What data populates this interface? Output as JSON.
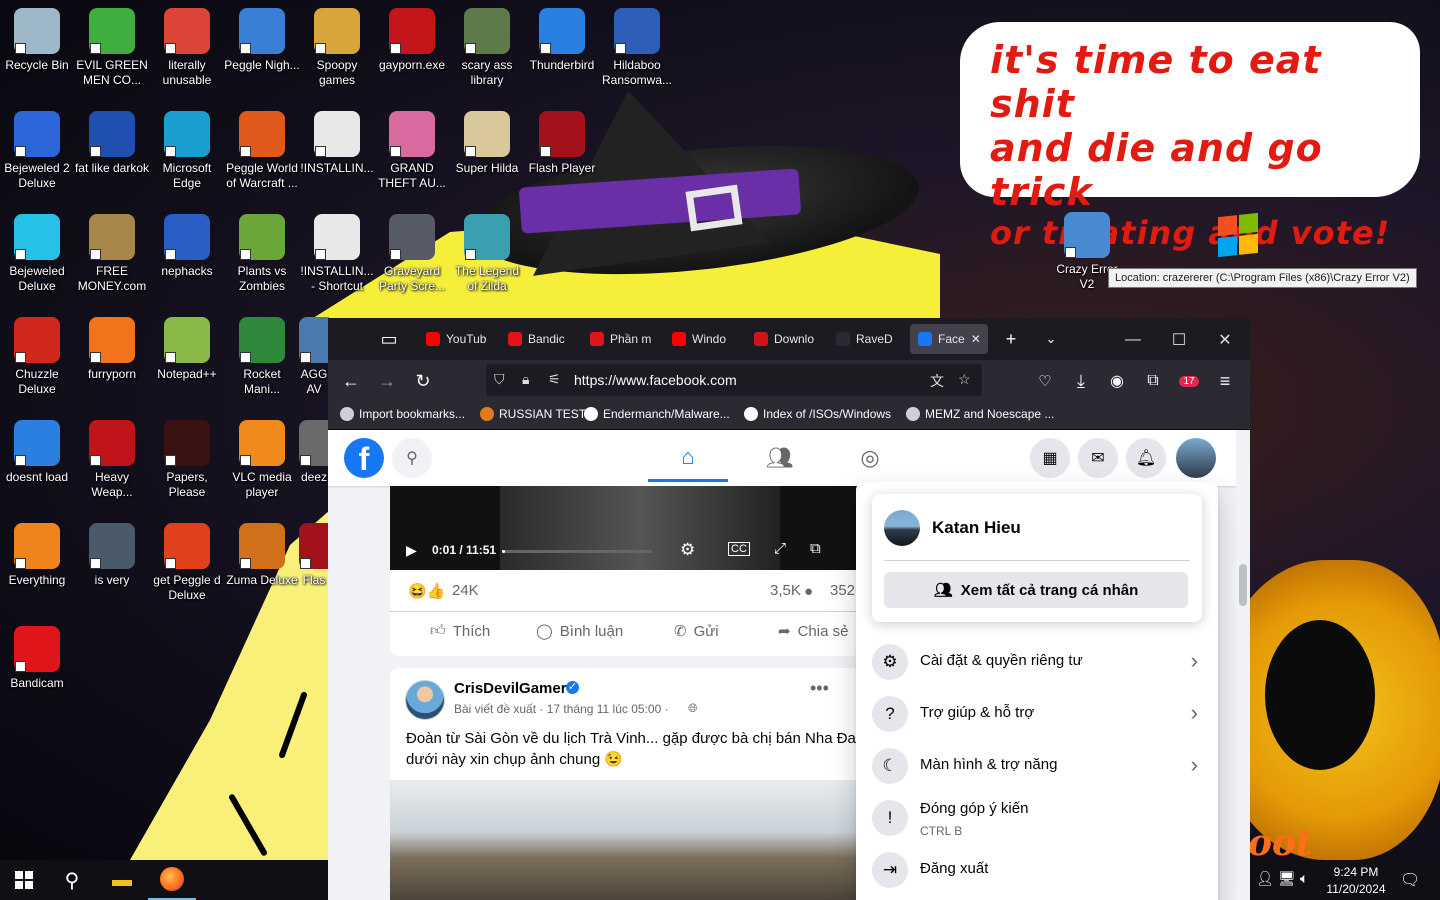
{
  "desktop": {
    "speech_bubble": [
      "it's time to eat shit",
      "and die and go trick",
      "or treating and vote!"
    ],
    "pumpkin_text": "oot",
    "icons": [
      {
        "label": "Recycle Bin",
        "icon": "recycle-bin-icon",
        "color": "#9fb8c9"
      },
      {
        "label": "EVIL GREEN MEN CO...",
        "icon": "people-icon",
        "color": "#3fae3f"
      },
      {
        "label": "literally unusable",
        "icon": "chrome-icon",
        "color": "#db4437"
      },
      {
        "label": "Peggle Nigh...",
        "icon": "peggle-icon",
        "color": "#3a7fd6"
      },
      {
        "label": "Spoopy games",
        "icon": "folder-icon",
        "color": "#d7a63a"
      },
      {
        "label": "gayporn.exe",
        "icon": "flash-icon",
        "color": "#c4151b"
      },
      {
        "label": "scary ass library",
        "icon": "library-icon",
        "color": "#5f7a4a"
      },
      {
        "label": "Thunderbird",
        "icon": "thunderbird-icon",
        "color": "#2a7fe0"
      },
      {
        "label": "Hildaboo Ransomwa...",
        "icon": "shield-icon",
        "color": "#2d5fb8"
      },
      {
        "label": "Bejeweled 2 Deluxe",
        "icon": "bejeweled-icon",
        "color": "#2c66d8"
      },
      {
        "label": "fat like darkok",
        "icon": "mpi-icon",
        "color": "#1f4fb0"
      },
      {
        "label": "Microsoft Edge",
        "icon": "edge-icon",
        "color": "#1aa0d0"
      },
      {
        "label": "Peggle World of Warcraft ...",
        "icon": "peggle-icon",
        "color": "#e05a1c"
      },
      {
        "label": "!INSTALLIN...",
        "icon": "document-icon",
        "color": "#e8e8e8"
      },
      {
        "label": "GRAND THEFT AU...",
        "icon": "gta-icon",
        "color": "#d86aa0"
      },
      {
        "label": "Super Hilda",
        "icon": "pixel-icon",
        "color": "#d9c89a"
      },
      {
        "label": "Flash Player",
        "icon": "flash-icon",
        "color": "#a5111a"
      },
      {
        "label": "Bejeweled Deluxe",
        "icon": "diamond-icon",
        "color": "#27c1e8"
      },
      {
        "label": "FREE MONEY.com",
        "icon": "money-bag-icon",
        "color": "#a8874a"
      },
      {
        "label": "nephacks",
        "icon": "mpi-icon",
        "color": "#2a5ec4"
      },
      {
        "label": "Plants vs Zombies",
        "icon": "flower-icon",
        "color": "#6aa63a"
      },
      {
        "label": "!INSTALLIN... - Shortcut",
        "icon": "document-icon",
        "color": "#e8e8e8"
      },
      {
        "label": "Graveyard Party Scre...",
        "icon": "grave-icon",
        "color": "#555a66"
      },
      {
        "label": "The Legend of Zilda",
        "icon": "zilda-icon",
        "color": "#3aa0b0"
      },
      {
        "label": "Chuzzle Deluxe",
        "icon": "chuzzle-icon",
        "color": "#d0281c"
      },
      {
        "label": "furryporn",
        "icon": "firefox-icon",
        "color": "#f2731c"
      },
      {
        "label": "Notepad++",
        "icon": "notepad-icon",
        "color": "#8ab94a"
      },
      {
        "label": "Rocket Mani...",
        "icon": "rocket-icon",
        "color": "#2e8a3a"
      },
      {
        "label": "AGG AV",
        "icon": "app-icon",
        "color": "#4a7ab0"
      },
      {
        "label": "doesnt load",
        "icon": "thunderbird-icon",
        "color": "#2a7fe0"
      },
      {
        "label": "Heavy Weap...",
        "icon": "radiation-icon",
        "color": "#c0141b"
      },
      {
        "label": "Papers, Please",
        "icon": "papers-icon",
        "color": "#3a1212"
      },
      {
        "label": "VLC media player",
        "icon": "vlc-icon",
        "color": "#f08a1a"
      },
      {
        "label": "deez",
        "icon": "app-icon",
        "color": "#6a6a6a"
      },
      {
        "label": "Everything",
        "icon": "search-icon",
        "color": "#f0841c"
      },
      {
        "label": "is very",
        "icon": "mpi-icon",
        "color": "#4a5a6a"
      },
      {
        "label": "get Peggle d Deluxe",
        "icon": "peggle-icon",
        "color": "#e0401c"
      },
      {
        "label": "Zuma Deluxe",
        "icon": "zuma-icon",
        "color": "#d0701a"
      },
      {
        "label": "Flas",
        "icon": "flash-icon",
        "color": "#a5111a"
      },
      {
        "label": "Bandicam",
        "icon": "record-icon",
        "color": "#e0141b"
      },
      {
        "label": "Crazy Error V2",
        "icon": "crazy-error-icon",
        "color": "#4a8ad0"
      }
    ],
    "location_tooltip": "Location: crazererer (C:\\Program Files (x86)\\Crazy Error V2)"
  },
  "taskbar": {
    "time": "9:24 PM",
    "date": "11/20/2024"
  },
  "browser": {
    "tabs": [
      {
        "label": "YouTub",
        "color": "#ff0000"
      },
      {
        "label": "Bandic",
        "color": "#e0141b"
      },
      {
        "label": "Phần m",
        "color": "#e0141b"
      },
      {
        "label": "Windo",
        "color": "#ff0000"
      },
      {
        "label": "Downlo",
        "color": "#d0141b"
      },
      {
        "label": "RaveD",
        "color": "#2b2a33"
      },
      {
        "label": "Face",
        "color": "#1877f2"
      }
    ],
    "url": "https://www.facebook.com",
    "downloads_badge": "17",
    "bookmarks": [
      {
        "label": "Import bookmarks...",
        "color": "#cfcfd8"
      },
      {
        "label": "RUSSIAN TEST",
        "color": "#e07a1c"
      },
      {
        "label": "Endermanch/Malware...",
        "color": "#ffffff"
      },
      {
        "label": "Index of /ISOs/Windows",
        "color": "#ffffff"
      },
      {
        "label": "MEMZ and Noescape ...",
        "color": "#cfcfd8"
      }
    ]
  },
  "facebook": {
    "video": {
      "time": "0:01 / 11:51",
      "progress": 0.02
    },
    "reactions_count": "24K",
    "comments_count": "3,5K",
    "shares_count": "352",
    "actions": {
      "like": "Thích",
      "comment": "Bình luận",
      "send": "Gửi",
      "share": "Chia sẻ"
    },
    "post": {
      "author": "CrisDevilGamer",
      "meta": "Bài viết đề xuất · 17 tháng 11 lúc 05:00 · ",
      "text_line1": "Đoàn từ Sài Gòn về du lịch Trà Vinh... gặp được bà chị bán Nha Đam",
      "text_line2": "dưới này xin chụp ảnh chung 😉"
    },
    "menu": {
      "profile_name": "Katan Hieu",
      "see_all_profiles": "Xem tất cả trang cá nhân",
      "items": [
        {
          "label": "Cài đặt & quyền riêng tư",
          "icon": "gear-icon",
          "sub": "",
          "chevron": true
        },
        {
          "label": "Trợ giúp & hỗ trợ",
          "icon": "help-icon",
          "sub": "",
          "chevron": true
        },
        {
          "label": "Màn hình & trợ năng",
          "icon": "moon-icon",
          "sub": "",
          "chevron": true
        },
        {
          "label": "Đóng góp ý kiến",
          "icon": "feedback-icon",
          "sub": "CTRL B",
          "chevron": false
        },
        {
          "label": "Đăng xuất",
          "icon": "logout-icon",
          "sub": "",
          "chevron": false
        }
      ]
    }
  }
}
